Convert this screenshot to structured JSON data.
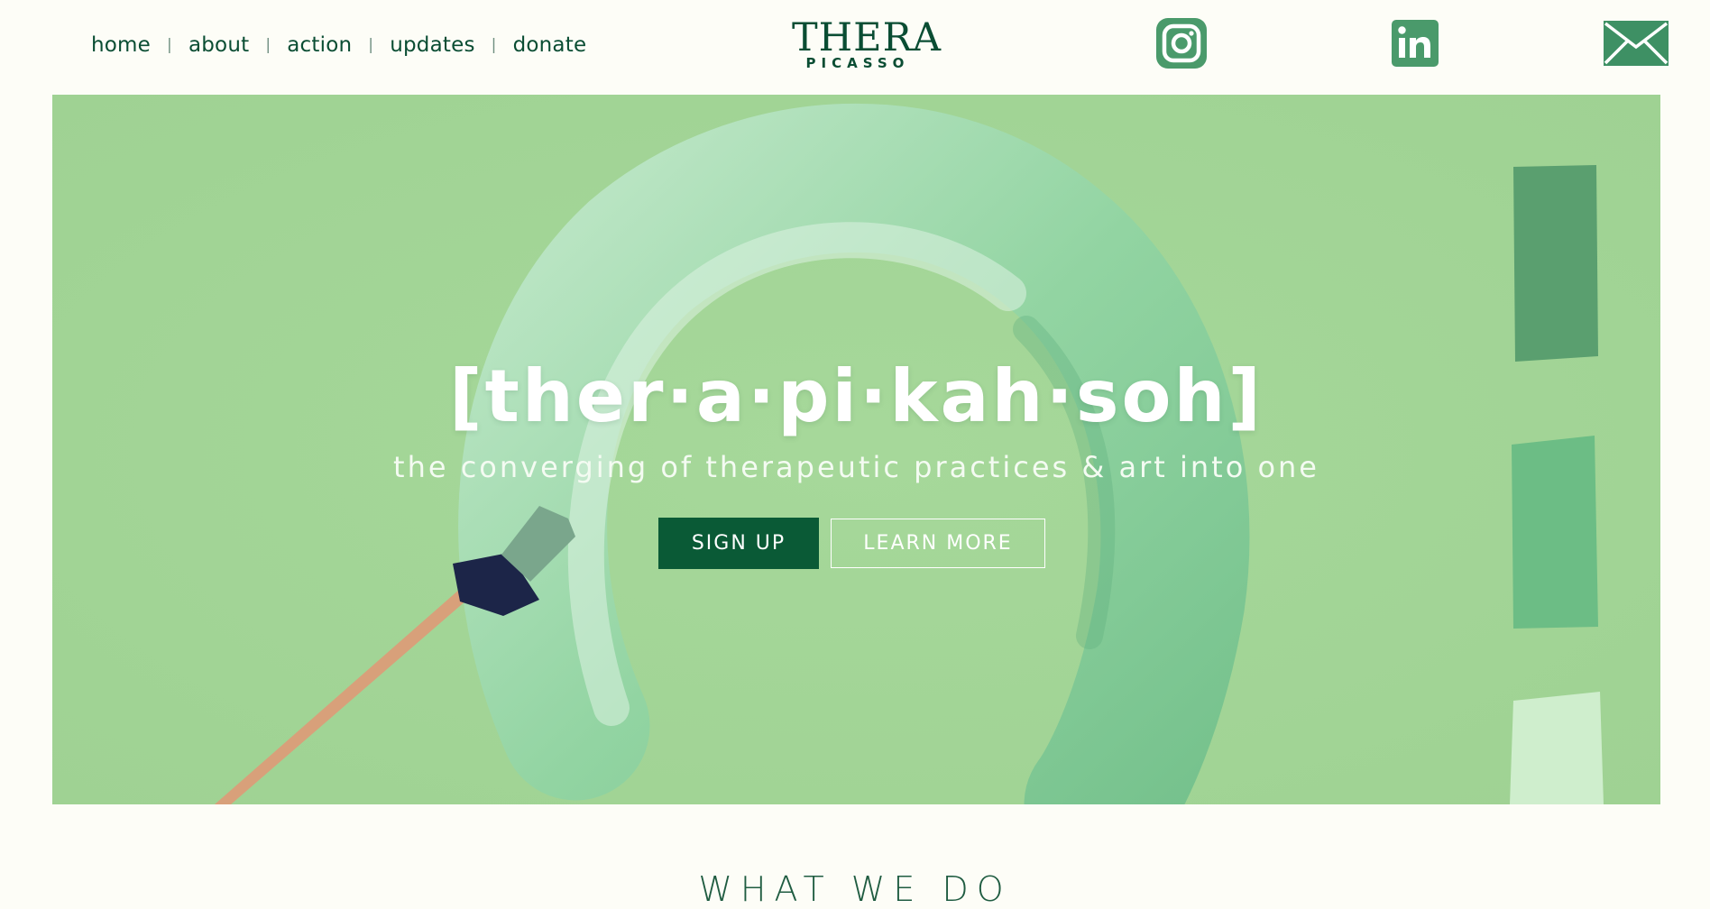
{
  "nav": {
    "items": [
      {
        "label": "home"
      },
      {
        "label": "about"
      },
      {
        "label": "action"
      },
      {
        "label": "updates"
      },
      {
        "label": "donate"
      }
    ],
    "separator": "|"
  },
  "logo": {
    "line1": "THERA",
    "line2": "PICASSO"
  },
  "social": {
    "instagram_icon": "instagram-icon",
    "linkedin_icon": "linkedin-icon",
    "mail_icon": "envelope-icon"
  },
  "hero": {
    "headline": "[ther·a·pi·kah·soh]",
    "tagline": "the converging of therapeutic practices & art into one",
    "signup_label": "SIGN UP",
    "learn_more_label": "LEARN MORE"
  },
  "section": {
    "title": "WHAT WE DO"
  },
  "colors": {
    "brand_green": "#0a4d33",
    "button_green": "#0a5a36",
    "hero_bg": "#a3d597",
    "page_bg": "#fdfdf7"
  }
}
